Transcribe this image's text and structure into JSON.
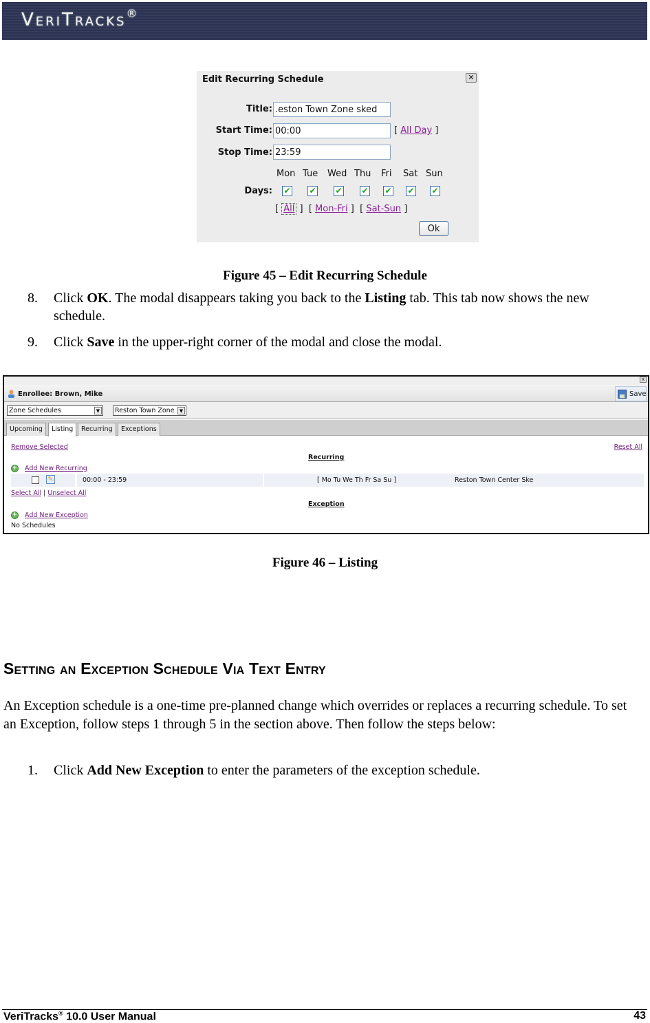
{
  "banner": {
    "logo_text": "VeriTracks",
    "logo_mark": "®"
  },
  "figure45": {
    "modal_title": "Edit Recurring Schedule",
    "close_label": "✕",
    "title_label": "Title:",
    "title_value": ".eston Town Zone sked",
    "start_label": "Start Time:",
    "start_value": "00:00",
    "all_day_link": "All Day",
    "stop_label": "Stop Time:",
    "stop_value": "23:59",
    "days_label": "Days:",
    "days": [
      {
        "name": "Mon",
        "checked": true
      },
      {
        "name": "Tue",
        "checked": true
      },
      {
        "name": "Wed",
        "checked": true
      },
      {
        "name": "Thu",
        "checked": true
      },
      {
        "name": "Fri",
        "checked": true
      },
      {
        "name": "Sat",
        "checked": true
      },
      {
        "name": "Sun",
        "checked": true
      }
    ],
    "check_mark": "✔",
    "quick_links": {
      "all": "All",
      "mon_fri": "Mon-Fri",
      "sat_sun": "Sat-Sun"
    },
    "ok_label": "Ok",
    "caption": "Figure 45 – Edit Recurring Schedule"
  },
  "steps_a": [
    {
      "num": "8.",
      "pre": "Click ",
      "bold": "OK",
      "mid": ". The modal disappears taking you back to the ",
      "bold2": "Listing",
      "post": " tab. This tab now shows the new schedule."
    },
    {
      "num": "9.",
      "pre": "Click ",
      "bold": "Save",
      "post": " in the upper-right corner of the modal and close the modal."
    }
  ],
  "figure46": {
    "close_label": "x",
    "enrollee": "Enrollee: Brown, Mike",
    "save_label": "Save",
    "schedule_type_select": "Zone Schedules",
    "zone_select": "Reston Town Zone",
    "tabs": [
      {
        "label": "Upcoming",
        "active": false
      },
      {
        "label": "Listing",
        "active": true
      },
      {
        "label": "Recurring",
        "active": false
      },
      {
        "label": "Exceptions",
        "active": false
      }
    ],
    "remove_selected": "Remove Selected",
    "reset_all": "Reset All",
    "recurring_heading": "Recurring",
    "add_new_recurring": "Add New Recurring",
    "recurring_rows": [
      {
        "time": "00:00 - 23:59",
        "days": "[ Mo Tu We Th Fr Sa Su ]",
        "title": "Reston Town Center Ske",
        "checked": false
      }
    ],
    "select_all": "Select All",
    "separator": "|",
    "unselect_all": "Unselect All",
    "exception_heading": "Exception",
    "add_new_exception": "Add New Exception",
    "no_schedules": "No Schedules",
    "caption": "Figure 46 – Listing"
  },
  "section": {
    "heading": "Setting an Exception Schedule Via Text Entry",
    "paragraph": "An Exception schedule is a one-time pre-planned change which overrides or replaces a recurring schedule. To set an Exception, follow steps 1 through 5 in the section above. Then follow the steps below:",
    "step": {
      "num": "1.",
      "pre": "Click ",
      "bold": "Add New Exception",
      "post": " to enter the parameters of the exception schedule."
    }
  },
  "footer": {
    "manual": "VeriTracks",
    "mark": "®",
    "version": " 10.0 User Manual",
    "page": "43"
  }
}
